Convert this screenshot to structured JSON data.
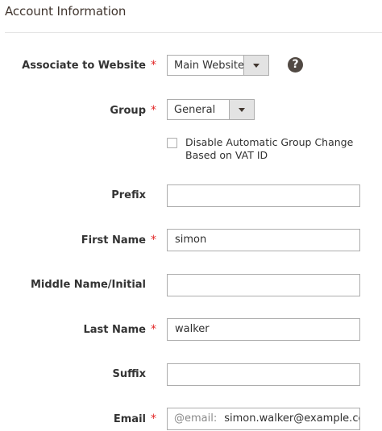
{
  "section": {
    "title": "Account Information"
  },
  "form": {
    "website": {
      "label": "Associate to Website",
      "required": "*",
      "value": "Main Website",
      "help_icon": "question-circle-icon",
      "help_glyph": "?"
    },
    "group": {
      "label": "Group",
      "required": "*",
      "value": "General"
    },
    "disable_group_change": {
      "label": "Disable Automatic Group Change Based on VAT ID",
      "checked": false
    },
    "prefix": {
      "label": "Prefix",
      "value": ""
    },
    "first_name": {
      "label": "First Name",
      "required": "*",
      "value": "simon"
    },
    "middle_name": {
      "label": "Middle Name/Initial",
      "value": ""
    },
    "last_name": {
      "label": "Last Name",
      "required": "*",
      "value": "walker"
    },
    "suffix": {
      "label": "Suffix",
      "value": ""
    },
    "email": {
      "label": "Email",
      "required": "*",
      "prefix": "@email:",
      "value": "simon.walker@example.com"
    }
  },
  "colors": {
    "required": "#e22626",
    "border": "#adadad",
    "select_button": "#e3e3e3",
    "help_icon": "#514943"
  }
}
